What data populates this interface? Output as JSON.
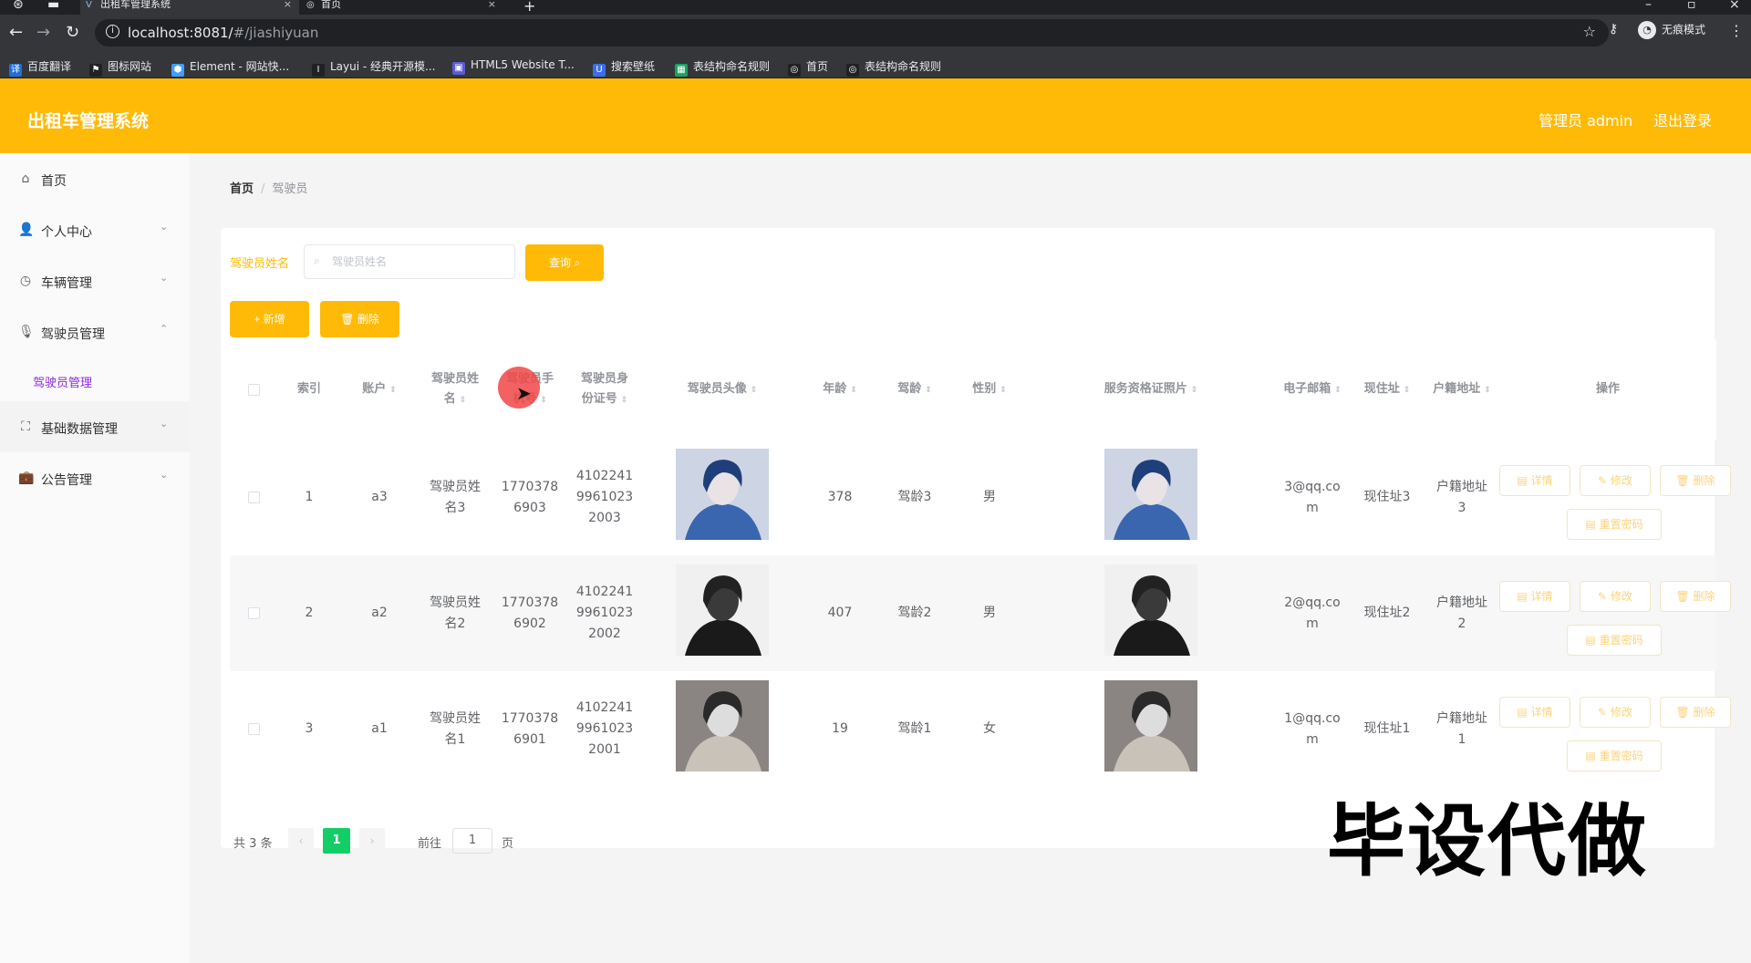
{
  "browser": {
    "tabs": [
      {
        "title": "出租车管理系统",
        "active": true
      },
      {
        "title": "首页",
        "active": false
      }
    ],
    "url_host": "localhost:8081/",
    "url_path": "#/jiashiyuan",
    "profile_label": "无痕模式",
    "bookmarks": [
      {
        "label": "百度翻译",
        "color": "#1e6fd9",
        "glyph": "译"
      },
      {
        "label": "图标网站",
        "color": "#202124",
        "glyph": "⚑"
      },
      {
        "label": "Element - 网站快...",
        "color": "#409eff",
        "glyph": "⬢"
      },
      {
        "label": "Layui - 经典开源模...",
        "color": "#202124",
        "glyph": "Ⅰ"
      },
      {
        "label": "HTML5 Website T...",
        "color": "#5b5bd6",
        "glyph": "▣"
      },
      {
        "label": "搜索壁纸",
        "color": "#3b6ee8",
        "glyph": "U"
      },
      {
        "label": "表结构命名规则",
        "color": "#1aa260",
        "glyph": "▦"
      },
      {
        "label": "首页",
        "color": "#202124",
        "glyph": "◎"
      },
      {
        "label": "表结构命名规则",
        "color": "#202124",
        "glyph": "◎"
      }
    ]
  },
  "header": {
    "title": "出租车管理系统",
    "user": "管理员 admin",
    "logout": "退出登录"
  },
  "sidebar": {
    "items": [
      {
        "label": "首页",
        "icon": "home-icon",
        "glyph": "⌂",
        "chevron": ""
      },
      {
        "label": "个人中心",
        "icon": "user-icon",
        "glyph": "👤",
        "chevron": "⌄"
      },
      {
        "label": "车辆管理",
        "icon": "clock-icon",
        "glyph": "◷",
        "chevron": "⌄"
      },
      {
        "label": "驾驶员管理",
        "icon": "microphone-icon",
        "glyph": "🎙",
        "chevron": "⌃"
      },
      {
        "label": "基础数据管理",
        "icon": "fullscreen-icon",
        "glyph": "⛶",
        "chevron": "⌄"
      },
      {
        "label": "公告管理",
        "icon": "briefcase-icon",
        "glyph": "💼",
        "chevron": "⌄"
      }
    ],
    "sub_item": "驾驶员管理"
  },
  "breadcrumb": {
    "home": "首页",
    "current": "驾驶员"
  },
  "search": {
    "label": "驾驶员姓名",
    "placeholder": "驾驶员姓名",
    "query_button": "查询",
    "add_button": "+ 新增",
    "delete_button": "删除"
  },
  "table": {
    "headers": [
      {
        "key": "index",
        "label": "索引",
        "sortable": false
      },
      {
        "key": "account",
        "label": "账户",
        "sortable": true
      },
      {
        "key": "name",
        "label": "驾驶员姓\n名",
        "sortable": true
      },
      {
        "key": "phone",
        "label": "驾驶员手\n机号",
        "sortable": true
      },
      {
        "key": "idcard",
        "label": "驾驶员身\n份证号",
        "sortable": true
      },
      {
        "key": "avatar",
        "label": "驾驶员头像",
        "sortable": true
      },
      {
        "key": "age",
        "label": "年龄",
        "sortable": true
      },
      {
        "key": "driving_age",
        "label": "驾龄",
        "sortable": true
      },
      {
        "key": "gender",
        "label": "性别",
        "sortable": true
      },
      {
        "key": "cert_photo",
        "label": "服务资格证照片",
        "sortable": true
      },
      {
        "key": "email",
        "label": "电子邮箱",
        "sortable": true
      },
      {
        "key": "current_addr",
        "label": "现住址",
        "sortable": true
      },
      {
        "key": "hukou_addr",
        "label": "户籍地址",
        "sortable": true
      },
      {
        "key": "ops",
        "label": "操作",
        "sortable": false
      }
    ],
    "rows": [
      {
        "index": "1",
        "account": "a3",
        "name": "驾驶员姓\n名3",
        "phone": "1770378\n6903",
        "idcard": "4102241\n9961023\n2003",
        "avatar_style": "blue",
        "age": "378",
        "driving_age": "驾龄3",
        "gender": "男",
        "email": "3@qq.co\nm",
        "current_addr": "现住址3",
        "hukou_addr": "户籍地址\n3"
      },
      {
        "index": "2",
        "account": "a2",
        "name": "驾驶员姓\n名2",
        "phone": "1770378\n6902",
        "idcard": "4102241\n9961023\n2002",
        "avatar_style": "dark",
        "age": "407",
        "driving_age": "驾龄2",
        "gender": "男",
        "email": "2@qq.co\nm",
        "current_addr": "现住址2",
        "hukou_addr": "户籍地址\n2"
      },
      {
        "index": "3",
        "account": "a1",
        "name": "驾驶员姓\n名1",
        "phone": "1770378\n6901",
        "idcard": "4102241\n9961023\n2001",
        "avatar_style": "gray",
        "age": "19",
        "driving_age": "驾龄1",
        "gender": "女",
        "email": "1@qq.co\nm",
        "current_addr": "现住址1",
        "hukou_addr": "户籍地址\n1"
      }
    ],
    "op_labels": {
      "detail": "详情",
      "edit": "修改",
      "delete": "删除",
      "reset": "重置密码"
    }
  },
  "pagination": {
    "total": "共 3 条",
    "current": "1",
    "goto_label": "前往",
    "goto_value": "1",
    "page_suffix": "页"
  },
  "overlay": {
    "watermark": "毕设代做"
  },
  "colors": {
    "accent": "#ffba07",
    "pager_active": "#13ce66",
    "submenu_active": "#8a2be2"
  }
}
